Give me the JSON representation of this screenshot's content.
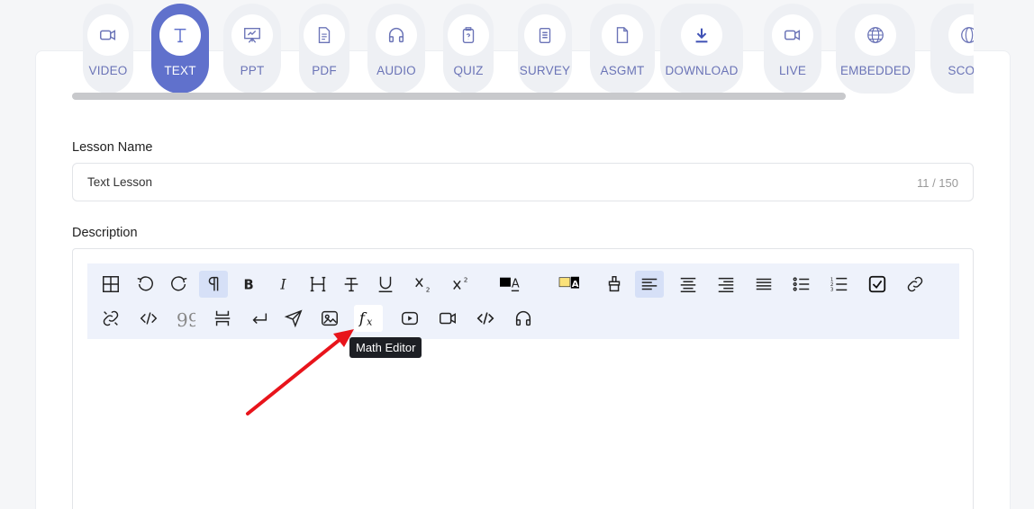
{
  "lesson_types": [
    {
      "label": "VIDEO",
      "icon": "video-icon",
      "active": false
    },
    {
      "label": "TEXT",
      "icon": "text-icon",
      "active": true
    },
    {
      "label": "PPT",
      "icon": "presentation-icon",
      "active": false
    },
    {
      "label": "PDF",
      "icon": "document-icon",
      "active": false
    },
    {
      "label": "AUDIO",
      "icon": "headphones-icon",
      "active": false
    },
    {
      "label": "QUIZ",
      "icon": "quiz-clipboard-icon",
      "active": false
    },
    {
      "label": "SURVEY",
      "icon": "survey-icon",
      "active": false
    },
    {
      "label": "ASGMT",
      "icon": "assignment-file-icon",
      "active": false
    },
    {
      "label": "DOWNLOAD",
      "icon": "download-icon",
      "active": false
    },
    {
      "label": "LIVE",
      "icon": "live-camera-icon",
      "active": false
    },
    {
      "label": "EMBEDDED",
      "icon": "globe-icon",
      "active": false
    },
    {
      "label": "SCORM",
      "icon": "scorm-globe-icon",
      "active": false
    }
  ],
  "lesson_name": {
    "label": "Lesson Name",
    "value": "Text Lesson",
    "counter": "11 / 150"
  },
  "description": {
    "label": "Description"
  },
  "toolbar_row1": [
    {
      "name": "table-icon",
      "state": ""
    },
    {
      "name": "undo-icon",
      "state": ""
    },
    {
      "name": "redo-icon",
      "state": ""
    },
    {
      "name": "paragraph-icon",
      "state": "on"
    },
    {
      "name": "bold-icon",
      "state": ""
    },
    {
      "name": "italic-icon",
      "state": ""
    },
    {
      "name": "heading-icon",
      "state": ""
    },
    {
      "name": "strikethrough-icon",
      "state": ""
    },
    {
      "name": "underline-icon",
      "state": ""
    },
    {
      "name": "subscript-icon",
      "state": ""
    },
    {
      "name": "superscript-icon",
      "state": ""
    },
    {
      "name": "text-color-icon",
      "state": ""
    },
    {
      "name": "highlight-color-icon",
      "state": ""
    },
    {
      "name": "clear-format-brush-icon",
      "state": ""
    },
    {
      "name": "align-left-icon",
      "state": "on"
    },
    {
      "name": "align-center-icon",
      "state": ""
    },
    {
      "name": "align-right-icon",
      "state": ""
    },
    {
      "name": "align-justify-icon",
      "state": ""
    },
    {
      "name": "bullet-list-icon",
      "state": ""
    },
    {
      "name": "numbered-list-icon",
      "state": ""
    },
    {
      "name": "checklist-icon",
      "state": ""
    },
    {
      "name": "link-icon",
      "state": ""
    }
  ],
  "toolbar_row2": [
    {
      "name": "unlink-icon",
      "state": ""
    },
    {
      "name": "code-icon",
      "state": ""
    },
    {
      "name": "blockquote-icon",
      "state": ""
    },
    {
      "name": "page-break-icon",
      "state": ""
    },
    {
      "name": "line-break-icon",
      "state": ""
    },
    {
      "name": "send-icon",
      "state": ""
    },
    {
      "name": "image-icon",
      "state": ""
    },
    {
      "name": "math-editor-icon",
      "state": "hover"
    },
    {
      "name": "youtube-icon",
      "state": ""
    },
    {
      "name": "video-embed-icon",
      "state": ""
    },
    {
      "name": "html-embed-icon",
      "state": ""
    },
    {
      "name": "audio-headphones-icon",
      "state": ""
    }
  ],
  "tooltip": "Math Editor",
  "colors": {
    "accent": "#6071cc",
    "label": "#6b74b7",
    "annotation_arrow": "#e8141b"
  }
}
